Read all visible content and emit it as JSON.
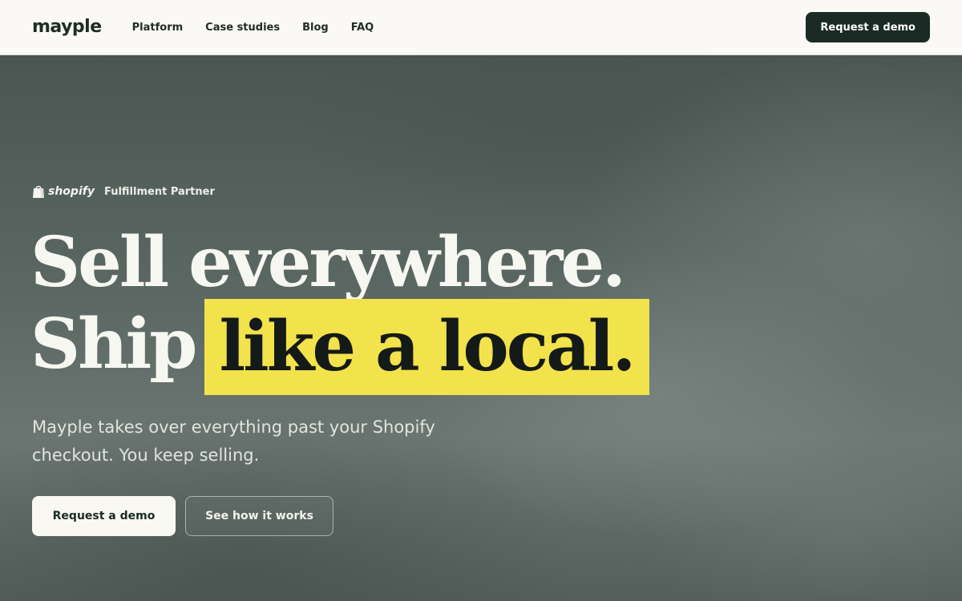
{
  "nav": {
    "logo": "mayple",
    "links": [
      "Platform",
      "Case studies",
      "Blog",
      "FAQ"
    ],
    "cta_label": "Request a demo"
  },
  "hero": {
    "badge": {
      "icon": "shopping-bag-icon",
      "brand": "shopify",
      "label": "Fulfillment Partner"
    },
    "headline_line1": "Sell everywhere.",
    "headline_line2_prefix": "Ship",
    "headline_line2_highlight": "like a local.",
    "subtext": "Mayple takes over everything past your Shopify checkout. You keep selling.",
    "primary_cta": "Request a demo",
    "secondary_cta": "See how it works"
  },
  "colors": {
    "nav_bg": "#faf9f5",
    "brand_dark": "#1b2a24",
    "highlight": "#f2e24b",
    "hero_text": "#f7f7f2"
  }
}
